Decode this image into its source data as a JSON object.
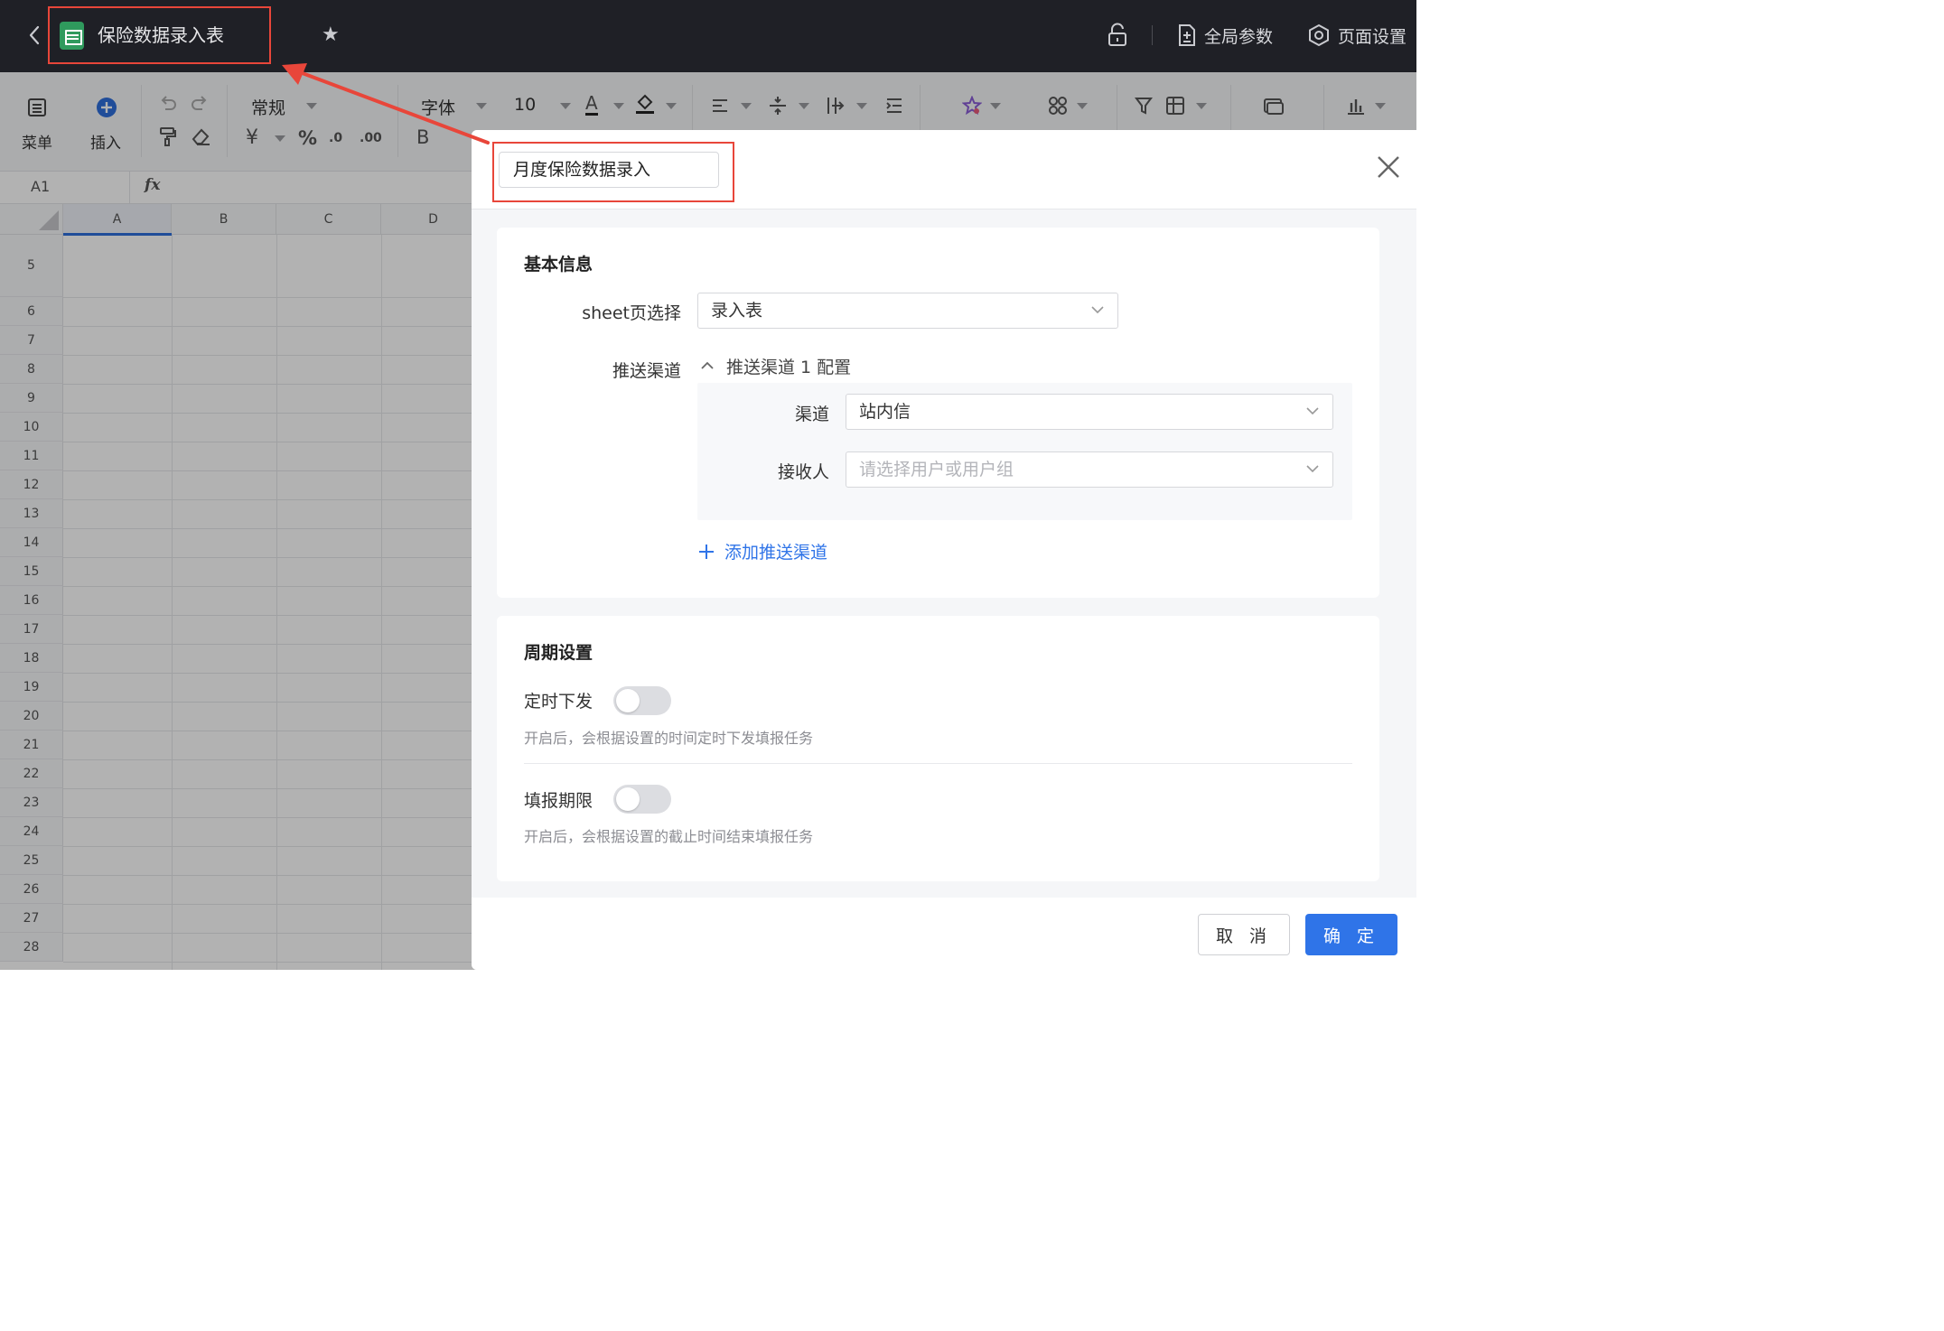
{
  "topbar": {
    "doc_title": "保险数据录入表",
    "global_params": "全局参数",
    "page_settings": "页面设置"
  },
  "toolbar": {
    "menu": "菜单",
    "insert": "插入",
    "format": "常规",
    "font": "字体",
    "font_size": "10",
    "bold": "B",
    "currency": "¥",
    "percent": "%",
    "dec_less": ".0",
    "dec_more": ".00",
    "font_color_glyph": "A"
  },
  "formula_bar": {
    "cell_ref": "A1",
    "fx": "fx"
  },
  "grid": {
    "columns": [
      "A",
      "B",
      "C",
      "D"
    ],
    "rows": [
      "5",
      "6",
      "7",
      "8",
      "9",
      "10",
      "11",
      "12",
      "13",
      "14",
      "15",
      "16",
      "17",
      "18",
      "19",
      "20",
      "21",
      "22",
      "23",
      "24",
      "25",
      "26",
      "27",
      "28"
    ]
  },
  "dialog": {
    "name_value": "月度保险数据录入",
    "basic": {
      "title": "基本信息",
      "sheet_label": "sheet页选择",
      "sheet_value": "录入表",
      "push_label": "推送渠道",
      "push_config": "推送渠道 1 配置",
      "channel_label": "渠道",
      "channel_value": "站内信",
      "receiver_label": "接收人",
      "receiver_placeholder": "请选择用户或用户组",
      "add_channel": "添加推送渠道"
    },
    "period": {
      "title": "周期设置",
      "timed_label": "定时下发",
      "timed_hint": "开启后，会根据设置的时间定时下发填报任务",
      "deadline_label": "填报期限",
      "deadline_hint": "开启后，会根据设置的截止时间结束填报任务"
    },
    "cancel": "取 消",
    "confirm": "确 定"
  },
  "colors": {
    "accent": "#2f74e8",
    "annotation": "#e8463a",
    "topbar_bg": "#1f2026"
  }
}
